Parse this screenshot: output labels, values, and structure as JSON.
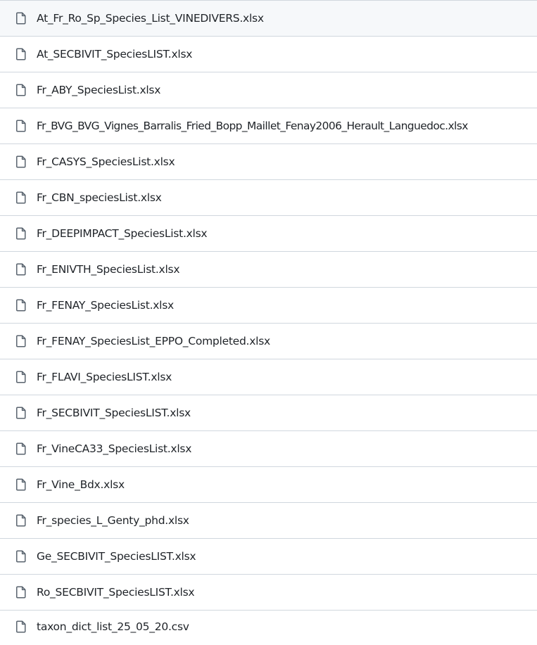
{
  "files": [
    {
      "name": "At_Fr_Ro_Sp_Species_List_VINEDIVERS.xlsx",
      "icon": "file-icon"
    },
    {
      "name": "At_SECBIVIT_SpeciesLIST.xlsx",
      "icon": "file-icon"
    },
    {
      "name": "Fr_ABY_SpeciesList.xlsx",
      "icon": "file-icon"
    },
    {
      "name": "Fr_BVG_BVG_Vignes_Barralis_Fried_Bopp_Maillet_Fenay2006_Herault_Languedoc.xlsx",
      "icon": "file-icon"
    },
    {
      "name": "Fr_CASYS_SpeciesList.xlsx",
      "icon": "file-icon"
    },
    {
      "name": "Fr_CBN_speciesList.xlsx",
      "icon": "file-icon"
    },
    {
      "name": "Fr_DEEPIMPACT_SpeciesList.xlsx",
      "icon": "file-icon"
    },
    {
      "name": "Fr_ENIVTH_SpeciesList.xlsx",
      "icon": "file-icon"
    },
    {
      "name": "Fr_FENAY_SpeciesList.xlsx",
      "icon": "file-icon"
    },
    {
      "name": "Fr_FENAY_SpeciesList_EPPO_Completed.xlsx",
      "icon": "file-icon"
    },
    {
      "name": "Fr_FLAVI_SpeciesLIST.xlsx",
      "icon": "file-icon"
    },
    {
      "name": "Fr_SECBIVIT_SpeciesLIST.xlsx",
      "icon": "file-icon"
    },
    {
      "name": "Fr_VineCA33_SpeciesList.xlsx",
      "icon": "file-icon"
    },
    {
      "name": "Fr_Vine_Bdx.xlsx",
      "icon": "file-icon"
    },
    {
      "name": "Fr_species_L_Genty_phd.xlsx",
      "icon": "file-icon"
    },
    {
      "name": "Ge_SECBIVIT_SpeciesLIST.xlsx",
      "icon": "file-icon"
    },
    {
      "name": "Ro_SECBIVIT_SpeciesLIST.xlsx",
      "icon": "file-icon"
    },
    {
      "name": "taxon_dict_list_25_05_20.csv",
      "icon": "file-icon"
    }
  ],
  "colors": {
    "text": "#1f2328",
    "icon": "#59636e",
    "divider": "#d0d7de",
    "background": "#ffffff"
  }
}
